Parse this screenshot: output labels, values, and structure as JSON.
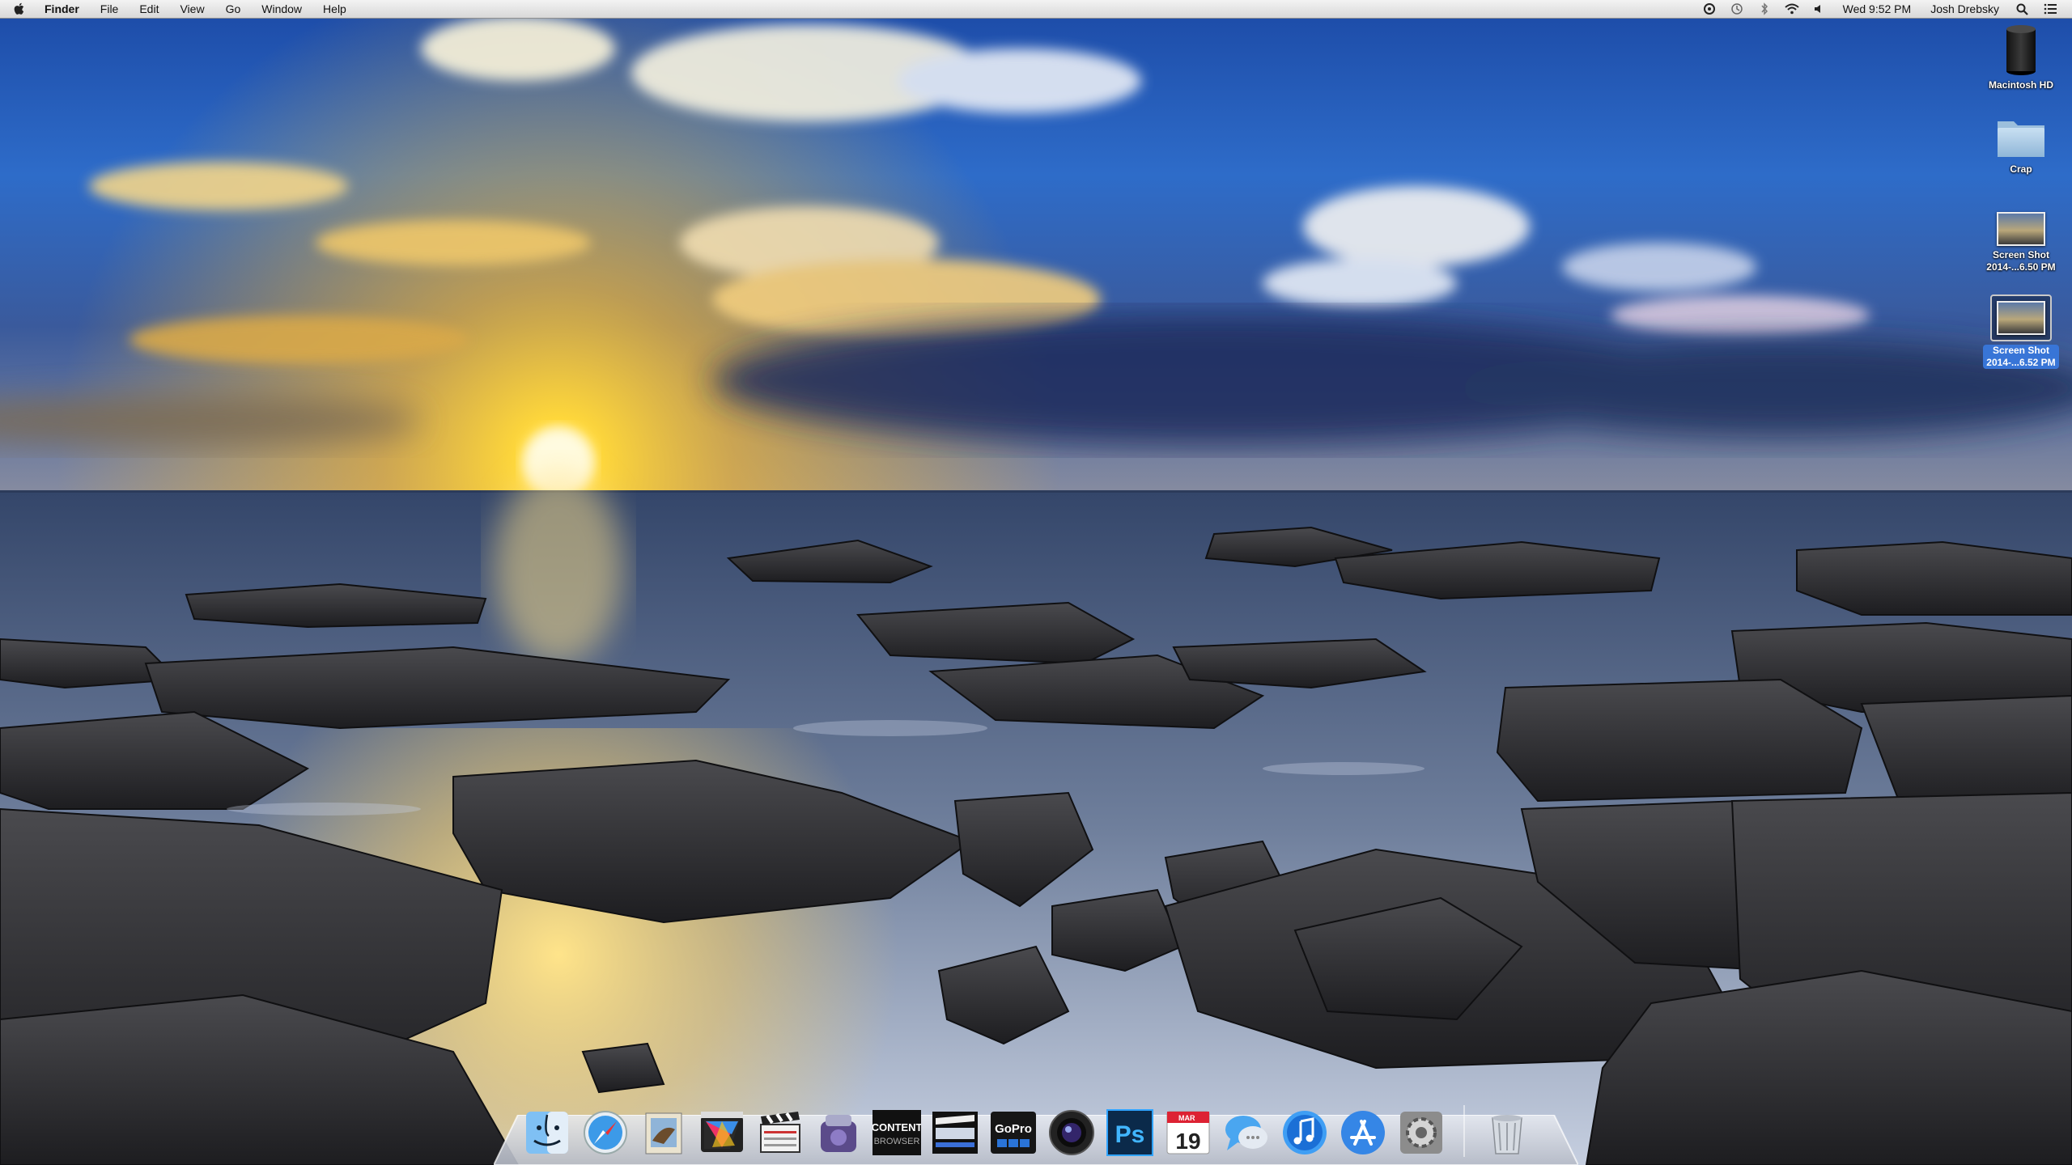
{
  "menubar": {
    "app_name": "Finder",
    "menus": [
      "File",
      "Edit",
      "View",
      "Go",
      "Window",
      "Help"
    ],
    "clock": "Wed 9:52 PM",
    "user": "Josh Drebsky",
    "status_icons": [
      "sync-icon",
      "time-machine-icon",
      "bluetooth-icon",
      "wifi-icon",
      "volume-icon",
      "spotlight-icon",
      "notification-center-icon"
    ]
  },
  "desktop": {
    "icons": [
      {
        "label": "Macintosh HD",
        "sublabel": "",
        "kind": "hard-drive-icon",
        "selected": false
      },
      {
        "label": "Crap",
        "sublabel": "",
        "kind": "folder-icon",
        "selected": false
      },
      {
        "label": "Screen Shot",
        "sublabel": "2014-...6.50 PM",
        "kind": "screenshot-thumbnail",
        "selected": false
      },
      {
        "label": "Screen Shot",
        "sublabel": "2014-...6.52 PM",
        "kind": "screenshot-thumbnail",
        "selected": true
      }
    ]
  },
  "dock": {
    "items": [
      {
        "name": "Finder",
        "icon": "finder-icon"
      },
      {
        "name": "Safari",
        "icon": "safari-icon"
      },
      {
        "name": "Mail",
        "icon": "mail-icon"
      },
      {
        "name": "Final Cut Pro",
        "icon": "final-cut-pro-icon"
      },
      {
        "name": "Clapperboard",
        "icon": "clapperboard-icon"
      },
      {
        "name": "Compressor",
        "icon": "compressor-icon"
      },
      {
        "name": "Content Browser",
        "icon": "content-browser-icon",
        "tile_line1": "CONTENT",
        "tile_line2": "BROWSER"
      },
      {
        "name": "Video Editor",
        "icon": "video-editor-icon"
      },
      {
        "name": "GoPro",
        "icon": "gopro-icon",
        "tile_text": "GoPro"
      },
      {
        "name": "Aperture",
        "icon": "aperture-icon"
      },
      {
        "name": "Photoshop",
        "icon": "photoshop-icon",
        "tile_text": "Ps"
      },
      {
        "name": "Calendar",
        "icon": "calendar-icon",
        "month": "MAR",
        "day": "19"
      },
      {
        "name": "Messages",
        "icon": "messages-icon"
      },
      {
        "name": "iTunes",
        "icon": "itunes-icon"
      },
      {
        "name": "App Store",
        "icon": "app-store-icon"
      },
      {
        "name": "System Preferences",
        "icon": "system-preferences-icon"
      },
      {
        "name": "Trash",
        "icon": "trash-icon"
      }
    ]
  },
  "colors": {
    "menubar_top": "#f3f3f3",
    "menubar_bottom": "#d8d8d8",
    "selection_blue": "#3875d7",
    "sky_top": "#1f4fa8",
    "sun_gold": "#ffd83a"
  }
}
